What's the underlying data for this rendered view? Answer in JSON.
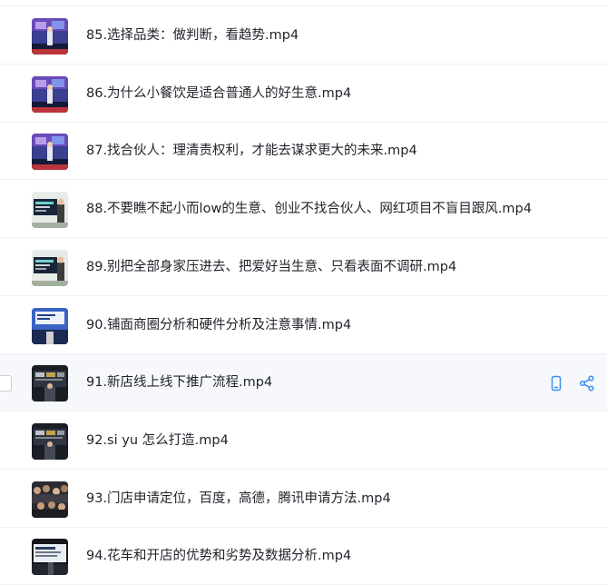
{
  "files": [
    {
      "name": "85.选择品类：做判断，看趋势.mp4",
      "thumb": "stage-blue"
    },
    {
      "name": "86.为什么小餐饮是适合普通人的好生意.mp4",
      "thumb": "stage-blue"
    },
    {
      "name": "87.找合伙人：理清责权利，才能去谋求更大的未来.mp4",
      "thumb": "stage-blue"
    },
    {
      "name": "88.不要瞧不起小而low的生意、创业不找合伙人、网红项目不盲目跟风.mp4",
      "thumb": "presenter-screen"
    },
    {
      "name": "89.别把全部身家压进去、把爱好当生意、只看表面不调研.mp4",
      "thumb": "presenter-screen"
    },
    {
      "name": "90.铺面商圈分析和硬件分析及注意事情.mp4",
      "thumb": "slide-blue"
    },
    {
      "name": "91.新店线上线下推广流程.mp4",
      "thumb": "dark-stage"
    },
    {
      "name": "92.si yu 怎么打造.mp4",
      "thumb": "dark-stage"
    },
    {
      "name": "93.门店申请定位，百度，高德，腾讯申请方法.mp4",
      "thumb": "audience"
    },
    {
      "name": "94.花车和开店的优势和劣势及数据分析.mp4",
      "thumb": "dark-slide"
    }
  ],
  "hovered_index": 6,
  "hover_actions": [
    {
      "icon": "phone-icon"
    },
    {
      "icon": "share-icon"
    }
  ],
  "colors": {
    "accent": "#3b8cf6",
    "text": "#1f2329",
    "hover_bg": "#f6f8fc",
    "divider": "#f0f1f3"
  }
}
